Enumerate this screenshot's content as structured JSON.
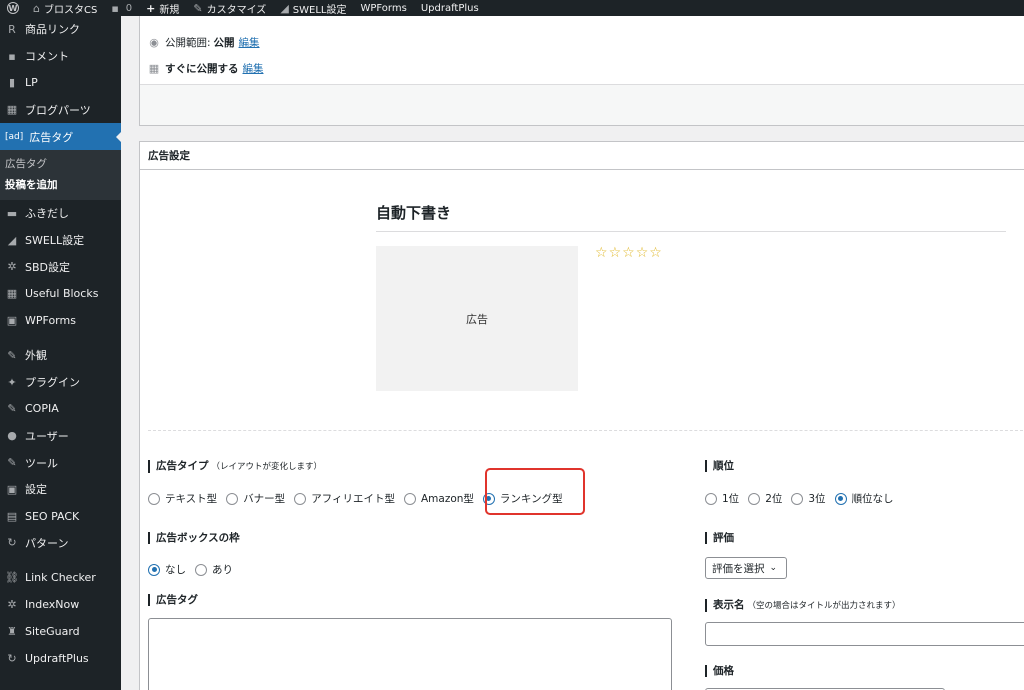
{
  "adminbar": {
    "site_name": "ブロスタCS",
    "comments_count": "0",
    "new_label": "新規",
    "customize_label": "カスタマイズ",
    "swell_label": "SWELL設定",
    "wpforms_label": "WPForms",
    "updraft_label": "UpdraftPlus"
  },
  "sidebar": {
    "items_top": [
      {
        "icon": "R",
        "label": "商品リンク"
      },
      {
        "icon": "▪",
        "label": "コメント"
      },
      {
        "icon": "▮",
        "label": "LP"
      },
      {
        "icon": "▦",
        "label": "ブログパーツ"
      }
    ],
    "current": {
      "icon": "[ad]",
      "label": "広告タグ"
    },
    "submenu": [
      "広告タグ",
      "投稿を追加"
    ],
    "items_mid": [
      {
        "icon": "▬",
        "label": "ふきだし"
      },
      {
        "icon": "◢",
        "label": "SWELL設定"
      },
      {
        "icon": "✲",
        "label": "SBD設定"
      },
      {
        "icon": "▦",
        "label": "Useful Blocks"
      },
      {
        "icon": "▣",
        "label": "WPForms"
      }
    ],
    "items_bottom": [
      {
        "icon": "✎",
        "label": "外観"
      },
      {
        "icon": "✦",
        "label": "プラグイン"
      },
      {
        "icon": "✎",
        "label": "COPIA"
      },
      {
        "icon": "●",
        "label": "ユーザー"
      },
      {
        "icon": "✎",
        "label": "ツール"
      },
      {
        "icon": "▣",
        "label": "設定"
      },
      {
        "icon": "▤",
        "label": "SEO PACK"
      },
      {
        "icon": "↻",
        "label": "パターン"
      }
    ],
    "items_plugins": [
      {
        "icon": "⛓",
        "label": "Link Checker"
      },
      {
        "icon": "✲",
        "label": "IndexNow"
      },
      {
        "icon": "♜",
        "label": "SiteGuard"
      },
      {
        "icon": "↻",
        "label": "UpdraftPlus"
      }
    ]
  },
  "publish": {
    "visibility_label": "公開範囲:",
    "visibility_value": "公開",
    "visibility_edit": "編集",
    "schedule_label": "すぐに公開する",
    "schedule_edit": "編集"
  },
  "ad_settings": {
    "box_title": "広告設定",
    "preview": {
      "title": "自動下書き",
      "image_label": "広告",
      "stars": [
        "☆",
        "☆",
        "☆",
        "☆",
        "☆"
      ],
      "rating_filled": 0
    },
    "ad_type": {
      "label": "広告タイプ",
      "note": "（レイアウトが変化します）",
      "options": [
        "テキスト型",
        "バナー型",
        "アフィリエイト型",
        "Amazon型",
        "ランキング型"
      ],
      "selected": "ランキング型"
    },
    "border": {
      "label": "広告ボックスの枠",
      "options": [
        "なし",
        "あり"
      ],
      "selected": "なし"
    },
    "ad_tag_label": "広告タグ",
    "rank": {
      "label": "順位",
      "options": [
        "1位",
        "2位",
        "3位",
        "順位なし"
      ],
      "selected": "順位なし"
    },
    "rating": {
      "label": "評価",
      "select_value": "評価を選択"
    },
    "display_name": {
      "label": "表示名",
      "note": "（空の場合はタイトルが出力されます）"
    },
    "price_label": "価格"
  },
  "colors": {
    "sidebar_bg": "#1d2327",
    "accent": "#2271b1",
    "highlight": "#e0342c",
    "star": "#e0b82a"
  }
}
